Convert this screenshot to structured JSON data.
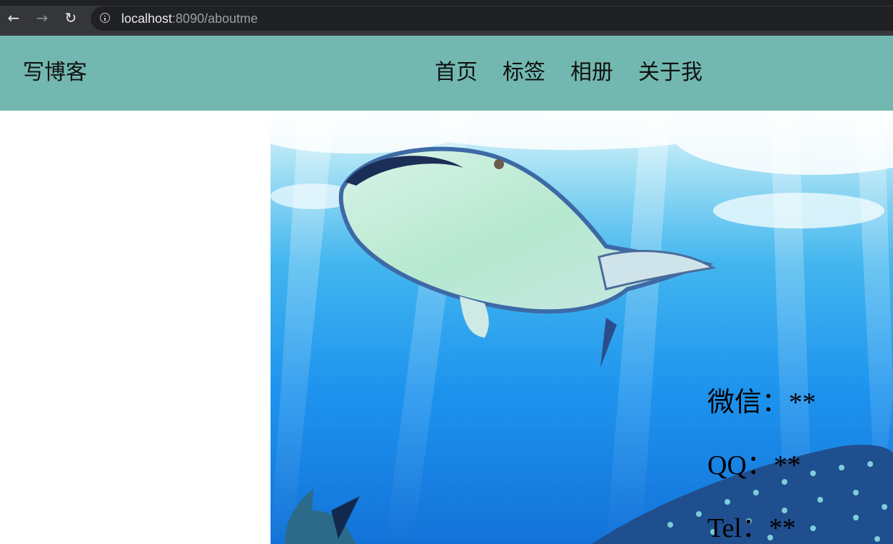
{
  "browser": {
    "url_host": "localhost",
    "url_rest": ":8090/aboutme",
    "icons": [
      "back-arrow-icon",
      "forward-arrow-icon",
      "reload-icon",
      "site-info-icon"
    ]
  },
  "header": {
    "brand": "写博客",
    "nav": [
      {
        "label": "首页"
      },
      {
        "label": "标签"
      },
      {
        "label": "相册"
      },
      {
        "label": "关于我"
      }
    ],
    "background_color": "#72b8b0"
  },
  "hero": {
    "image": "whale-shark-underwater"
  },
  "contact": {
    "wechat": "微信：**",
    "qq": "QQ：**",
    "tel": "Tel：**"
  }
}
